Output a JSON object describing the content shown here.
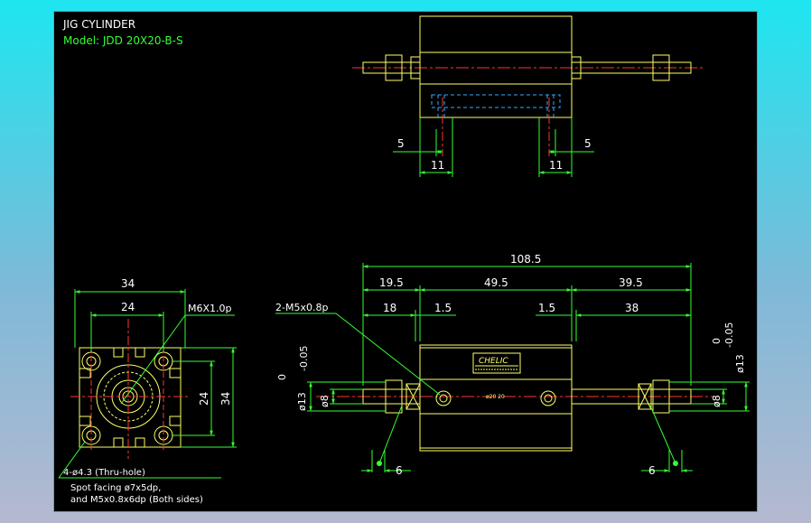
{
  "title_block": {
    "title": "JIG CYLINDER",
    "model": "Model: JDD 20X20-B-S"
  },
  "top_view": {
    "dim_left_small": "5",
    "dim_left_wide": "11",
    "dim_right_small": "5",
    "dim_right_wide": "11"
  },
  "end_view": {
    "width_outer": "34",
    "width_inner": "24",
    "height_inner": "24",
    "height_outer": "34",
    "center_thread": "M6X1.0p",
    "holes_note": "4-ø4.3 (Thru-hole)",
    "spot_facing_line1": "Spot facing ø7x5dp,",
    "spot_facing_line2": "and M5x0.8x6dp (Both sides)"
  },
  "side_view": {
    "overall_length": "108.5",
    "seg_left": "19.5",
    "seg_middle": "49.5",
    "seg_right": "39.5",
    "rod_left": "18",
    "gap_left": "1.5",
    "gap_right": "1.5",
    "rod_right": "38",
    "port_thread": "2-M5x0.8p",
    "brand": "CHELIC",
    "label_line1": "ø20 20",
    "rod_dia_left": "ø8",
    "rod_dia_right": "ø8",
    "tol_left_upper": "0",
    "tol_left_lower": "-0.05",
    "tol_left_dia": "ø13",
    "tol_right_upper": "0",
    "tol_right_lower": "-0.05",
    "tol_right_dia": "ø13",
    "flat_left": "6",
    "flat_right": "6"
  },
  "colors": {
    "background": "#000000",
    "outline": "#ffff66",
    "dimension": "#33ff33",
    "centerline": "#ff3333",
    "hidden": "#33aaff",
    "text": "#ffffff",
    "frame": "#1ee6f0"
  }
}
